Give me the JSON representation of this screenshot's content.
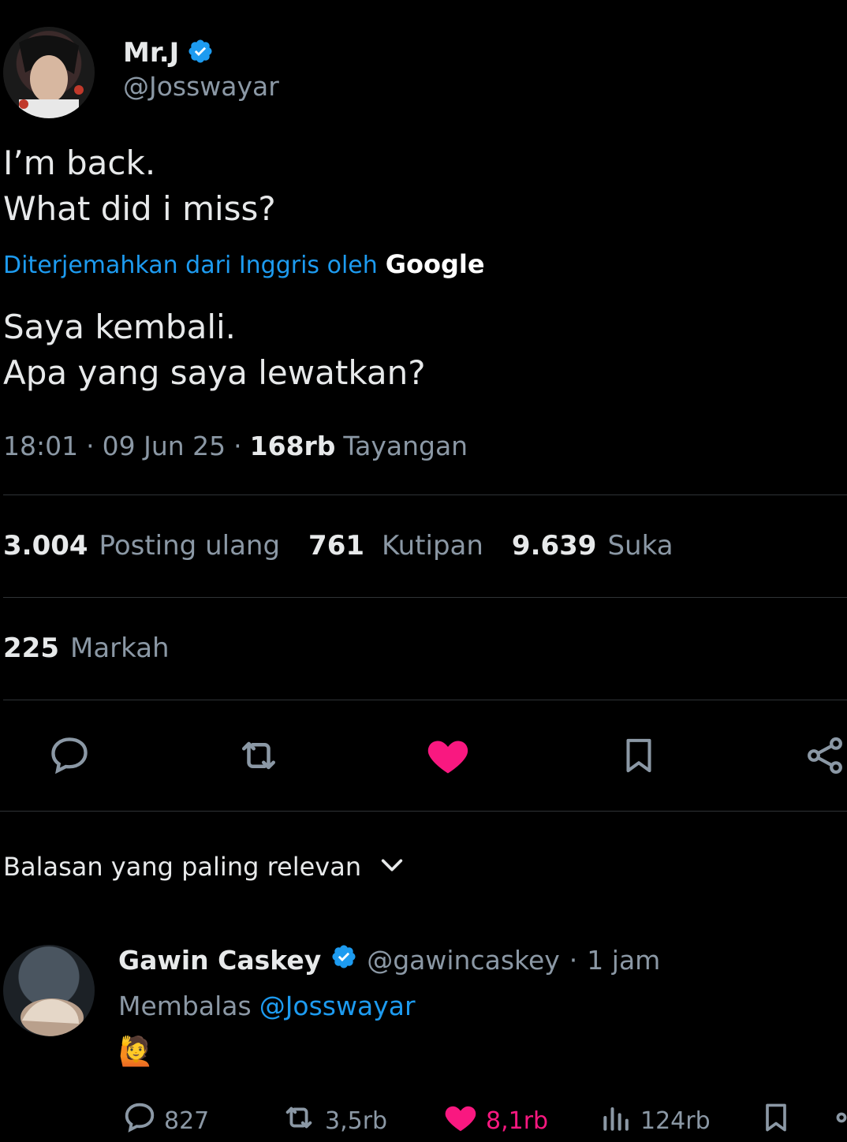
{
  "author": {
    "name": "Mr.J",
    "handle": "@Josswayar",
    "avatar_icon": "avatar-photo",
    "verified_icon": "verified-badge-icon"
  },
  "tweet": {
    "original_line1": "I’m back.",
    "original_line2": "What did i miss?",
    "translated_by": "Diterjemahkan dari Inggris oleh",
    "translator": "Google",
    "translation_line1": "Saya kembali.",
    "translation_line2": "Apa yang saya lewatkan?",
    "time": "18:01",
    "date": "09 Jun 25",
    "views_count": "168rb",
    "views_label": "Tayangan"
  },
  "stats": {
    "reposts_count": "3.004",
    "reposts_label": "Posting ulang",
    "quotes_count": "761",
    "quotes_label": "Kutipan",
    "likes_count": "9.639",
    "likes_label": "Suka",
    "bookmarks_count": "225",
    "bookmarks_label": "Markah"
  },
  "actions": {
    "reply_icon": "reply-icon",
    "retweet_icon": "retweet-icon",
    "like_icon": "heart-icon",
    "bookmark_icon": "bookmark-icon",
    "share_icon": "share-icon",
    "like_color": "#f91880",
    "icon_color": "#8b98a5"
  },
  "replies_sort": {
    "label": "Balasan yang paling relevan"
  },
  "reply": {
    "name": "Gawin Caskey",
    "handle": "@gawincaskey",
    "time": "1 jam",
    "replying_to_prefix": "Membalas",
    "replying_to": "@Josswayar",
    "body": "🙋",
    "reply_count": "827",
    "retweet_count": "3,5rb",
    "like_count": "8,1rb",
    "views_count": "124rb"
  },
  "colors": {
    "background": "#000000",
    "text": "#e7e9ea",
    "muted": "#8b98a5",
    "link": "#1d9bf0",
    "verified": "#1d9bf0",
    "like": "#f91880"
  }
}
